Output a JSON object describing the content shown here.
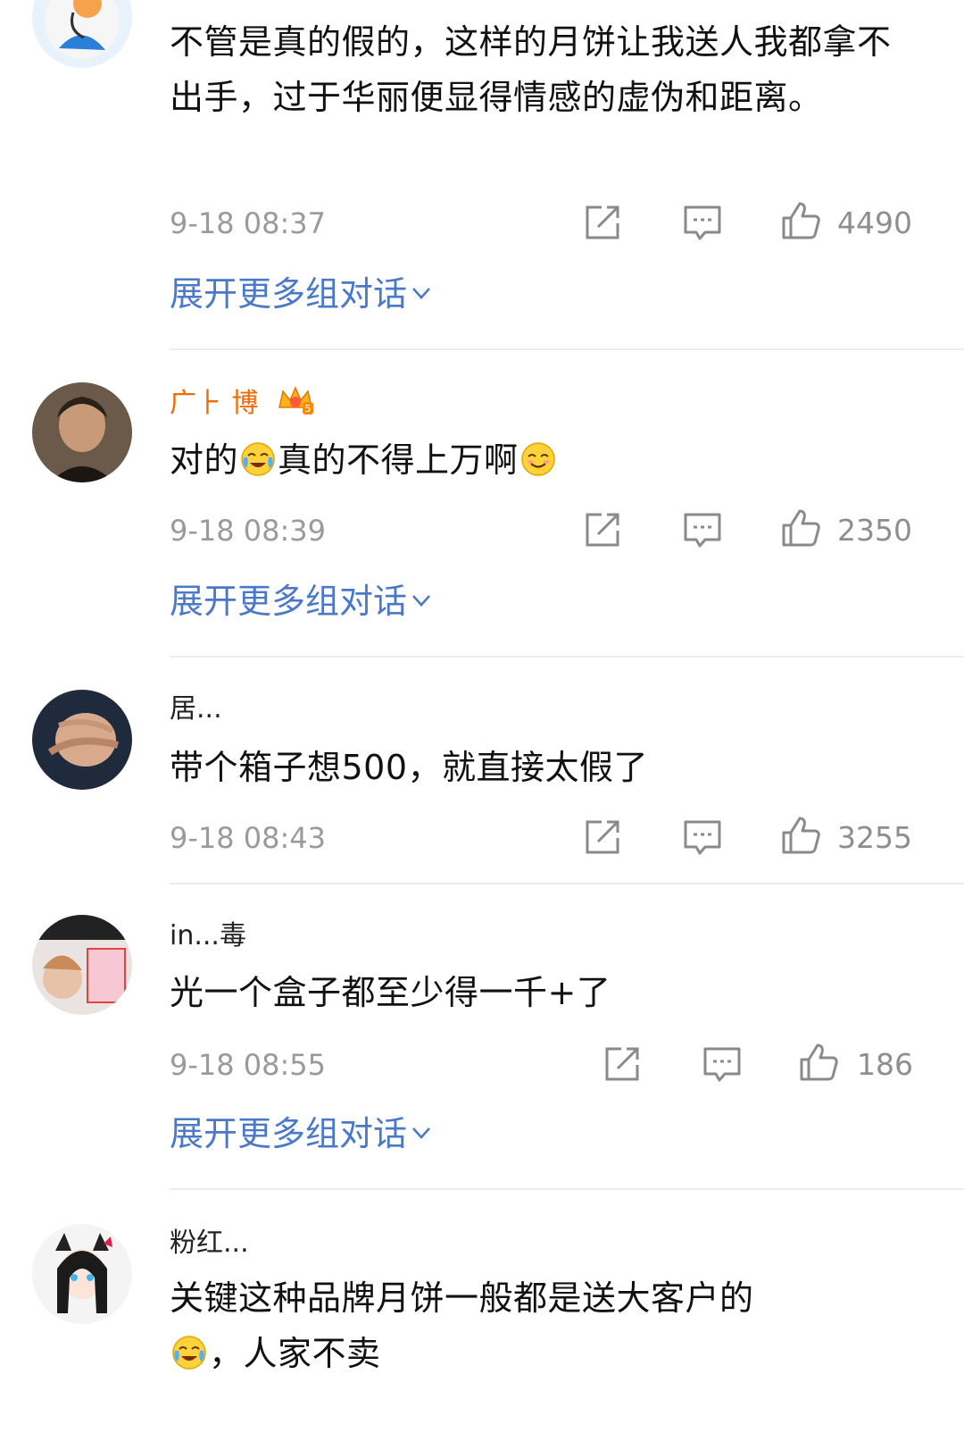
{
  "comments": [
    {
      "username": "",
      "text": "不管是真的假的，这样的月饼让我送人我都拿不出手，过于华丽便显得情感的虚伪和距离。",
      "time": "9-18 08:37",
      "likes": "4490",
      "expand": "展开更多组对话"
    },
    {
      "username": "广⺊ 博",
      "text_parts": [
        "对的",
        "真的不得上万啊"
      ],
      "time": "9-18 08:39",
      "likes": "2350",
      "expand": "展开更多组对话",
      "badge_number": "5"
    },
    {
      "username": "居...",
      "text": "带个箱子想500，就直接太假了",
      "time": "9-18 08:43",
      "likes": "3255"
    },
    {
      "username": "in...毒",
      "text": "光一个盒子都至少得一千+了",
      "time": "9-18 08:55",
      "likes": "186",
      "expand": "展开更多组对话"
    },
    {
      "username": "粉红...",
      "text_parts": [
        "关键这种品牌月饼一般都是送大客户的",
        "，人家不卖"
      ]
    }
  ],
  "icons": {
    "share": "share-icon",
    "reply": "comment-icon",
    "like": "thumbs-up-icon",
    "expand": "chevron-down-icon",
    "emoji_cry": "laugh-cry-emoji",
    "emoji_smile": "smile-emoji",
    "badge": "crown-badge-icon"
  },
  "colors": {
    "link": "#4b79c9",
    "vip_name": "#f06a00",
    "meta": "#9a9a9a",
    "text": "#111111"
  }
}
